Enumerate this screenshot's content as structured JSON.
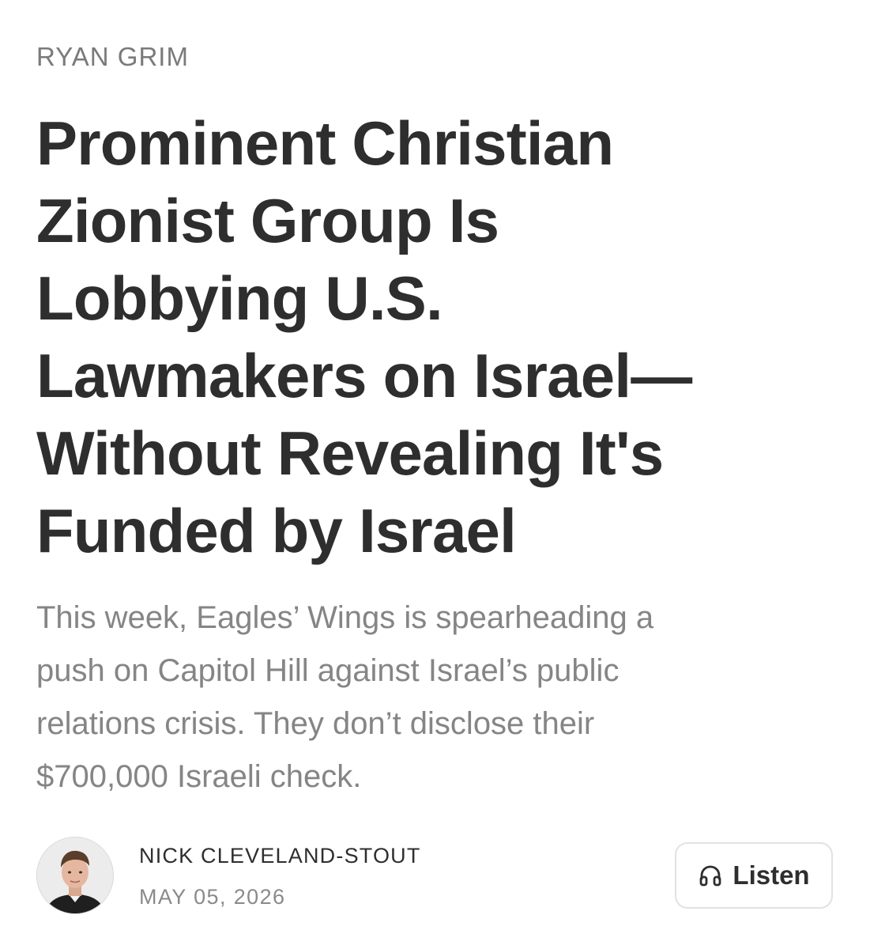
{
  "section": {
    "kicker": "RYAN GRIM"
  },
  "article": {
    "headline_lines": [
      "Prominent Christian",
      "Zionist Group Is",
      "Lobbying U.S.",
      "Lawmakers on Israel—",
      "Without Revealing It's",
      "Funded by Israel"
    ],
    "dek_lines": [
      "This week, Eagles’ Wings is spearheading a",
      "push on Capitol Hill against Israel’s public",
      "relations crisis. They don’t disclose their",
      "$700,000 Israeli check."
    ]
  },
  "byline": {
    "author": "NICK CLEVELAND-STOUT",
    "date": "MAY 05, 2026",
    "avatar_icon": "author-avatar"
  },
  "listen_button": {
    "label": "Listen",
    "icon": "headphones-icon"
  },
  "colors": {
    "headline": "#2e2e2e",
    "kicker": "#7a7a7a",
    "dek": "#858585",
    "button_border": "#e2e2e2"
  }
}
